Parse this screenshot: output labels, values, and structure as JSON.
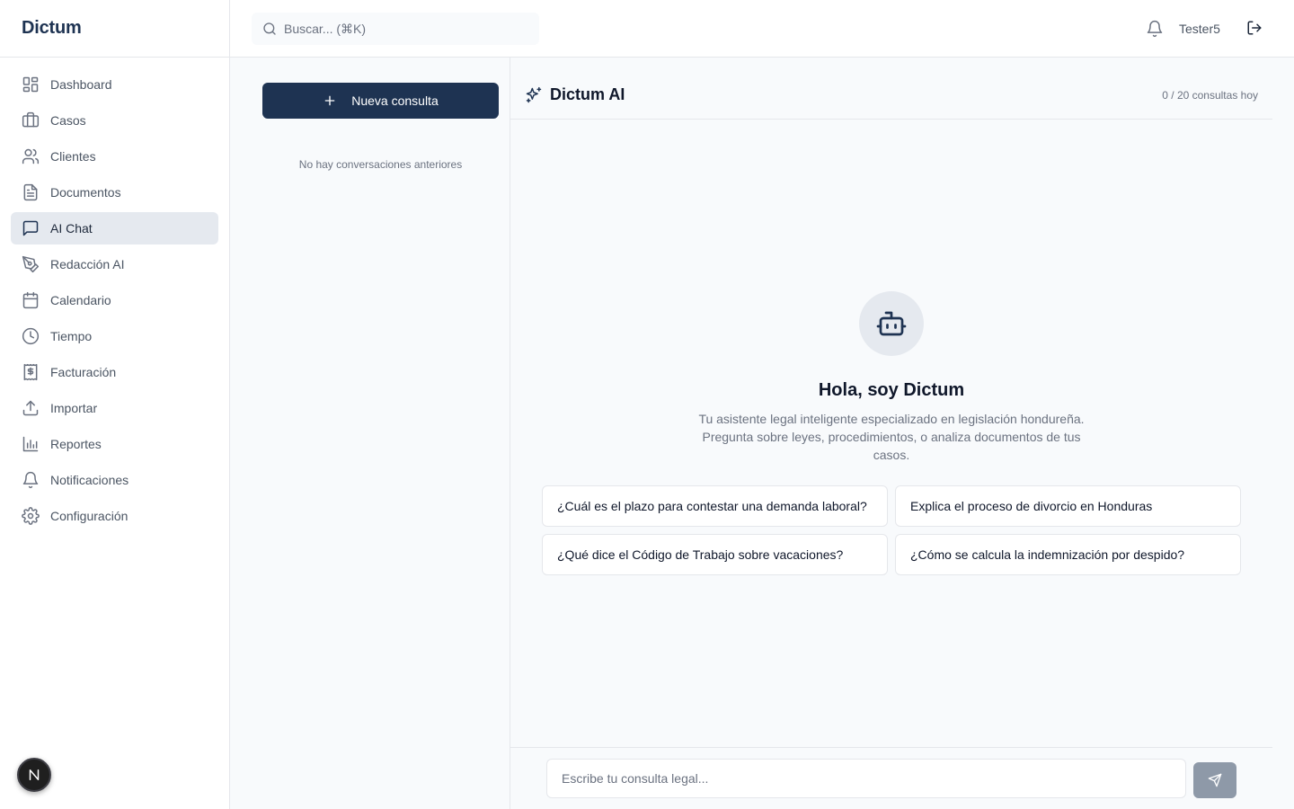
{
  "app": {
    "brand": "Dictum"
  },
  "sidebar": {
    "items": [
      {
        "label": "Dashboard",
        "icon": "dashboard-icon",
        "active": false
      },
      {
        "label": "Casos",
        "icon": "briefcase-icon",
        "active": false
      },
      {
        "label": "Clientes",
        "icon": "users-icon",
        "active": false
      },
      {
        "label": "Documentos",
        "icon": "file-text-icon",
        "active": false
      },
      {
        "label": "AI Chat",
        "icon": "message-square-icon",
        "active": true
      },
      {
        "label": "Redacción AI",
        "icon": "pen-tool-icon",
        "active": false
      },
      {
        "label": "Calendario",
        "icon": "calendar-icon",
        "active": false
      },
      {
        "label": "Tiempo",
        "icon": "clock-icon",
        "active": false
      },
      {
        "label": "Facturación",
        "icon": "receipt-icon",
        "active": false
      },
      {
        "label": "Importar",
        "icon": "upload-icon",
        "active": false
      },
      {
        "label": "Reportes",
        "icon": "bar-chart-icon",
        "active": false
      },
      {
        "label": "Notificaciones",
        "icon": "bell-icon",
        "active": false
      },
      {
        "label": "Configuración",
        "icon": "settings-icon",
        "active": false
      }
    ],
    "badge_letter": "N"
  },
  "header": {
    "search_placeholder": "Buscar... (⌘K)",
    "username": "Tester5"
  },
  "conversations": {
    "new_label": "Nueva consulta",
    "empty_text": "No hay conversaciones anteriores"
  },
  "chat": {
    "title": "Dictum AI",
    "quota": "0 / 20 consultas hoy",
    "greeting": "Hola, soy Dictum",
    "intro": "Tu asistente legal inteligente especializado en legislación hondureña. Pregunta sobre leyes, procedimientos, o analiza documentos de tus casos.",
    "suggestions": [
      "¿Cuál es el plazo para contestar una demanda laboral?",
      "Explica el proceso de divorcio en Honduras",
      "¿Qué dice el Código de Trabajo sobre vacaciones?",
      "¿Cómo se calcula la indemnización por despido?"
    ],
    "input_placeholder": "Escribe tu consulta legal..."
  },
  "colors": {
    "primary": "#1e3352",
    "active_bg": "#e5e9ef",
    "send_disabled": "#8e99a8",
    "border": "#e5e7eb",
    "muted_text": "#6b7280"
  }
}
